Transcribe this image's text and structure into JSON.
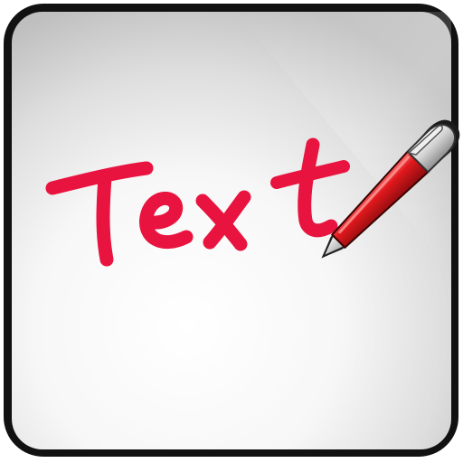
{
  "icon": {
    "word": "Text",
    "word_color": "#e8143f",
    "frame_color": "#111111",
    "background_light": "#ffffff",
    "background_dark": "#bdbdbd",
    "pen_body_color": "#d9191f",
    "pen_cap_color": "#d8d8d8",
    "icon_names": [
      "app-icon",
      "pen-icon"
    ]
  }
}
